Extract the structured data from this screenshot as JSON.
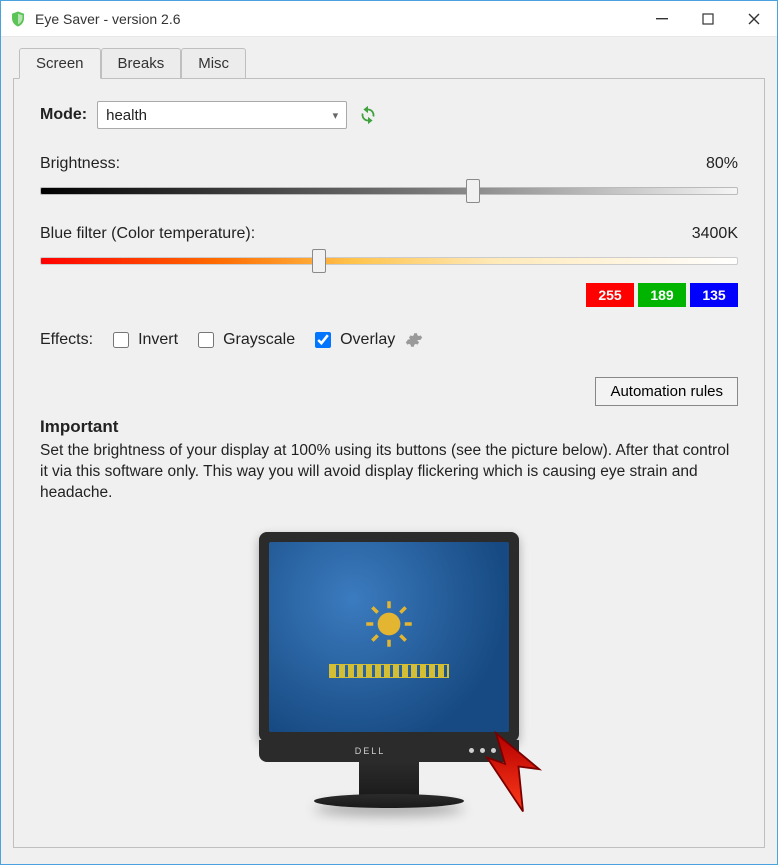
{
  "window": {
    "title": "Eye Saver - version 2.6"
  },
  "tabs": [
    {
      "label": "Screen"
    },
    {
      "label": "Breaks"
    },
    {
      "label": "Misc"
    }
  ],
  "mode": {
    "label": "Mode:",
    "value": "health"
  },
  "brightness": {
    "label": "Brightness:",
    "value_text": "80%",
    "percent": 62
  },
  "blue_filter": {
    "label": "Blue filter (Color temperature):",
    "value_text": "3400K",
    "percent": 40
  },
  "rgb": {
    "r": "255",
    "g": "189",
    "b": "135"
  },
  "effects": {
    "label": "Effects:",
    "invert": {
      "label": "Invert",
      "checked": false
    },
    "grayscale": {
      "label": "Grayscale",
      "checked": false
    },
    "overlay": {
      "label": "Overlay",
      "checked": true
    }
  },
  "automation_button": "Automation rules",
  "important": {
    "heading": "Important",
    "body": "Set the brightness of your display at 100% using its buttons (see the picture below). After that control it via this software only. This way you will avoid display flickering which is causing eye strain and headache."
  },
  "monitor": {
    "brand": "DELL"
  },
  "colors": {
    "r": "#ff0000",
    "g": "#00b400",
    "b": "#0000ff"
  }
}
